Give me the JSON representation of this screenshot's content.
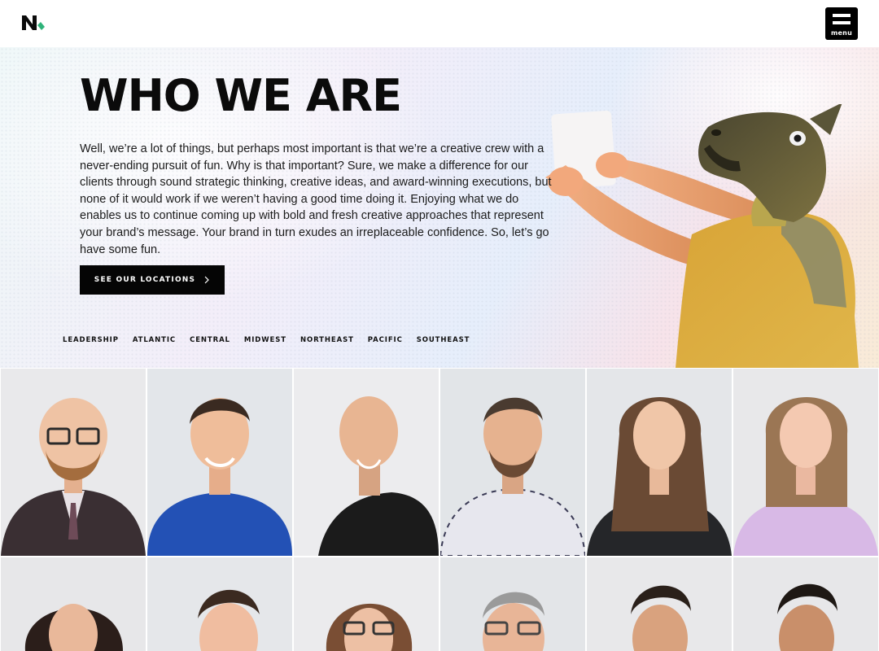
{
  "header": {
    "logo": "N",
    "logo_icon": "brand-logo-icon",
    "menu_label": "menu",
    "menu_icon": "hamburger-menu-icon"
  },
  "hero": {
    "title": "WHO WE ARE",
    "body": "Well, we’re a lot of things, but perhaps most important is that we’re a creative crew with a never-ending pursuit of fun. Why is that important? Sure, we make a difference for our clients through sound strategic thinking, creative ideas, and award-winning executions, but none of it would work if we weren’t having a good time doing it. Enjoying what we do enables us to continue coming up with bold and fresh creative approaches that represent your brand’s message. Your brand in turn exudes an irreplaceable confidence. So, let’s go have some fun.",
    "cta_label": "SEE OUR LOCATIONS",
    "cta_icon": "chevron-right-icon"
  },
  "regions": [
    "LEADERSHIP",
    "ATLANTIC",
    "CENTRAL",
    "MIDWEST",
    "NORTHEAST",
    "PACIFIC",
    "SOUTHEAST"
  ],
  "colors": {
    "accent": "#2fb37a",
    "button_bg": "#050505",
    "text": "#111111"
  }
}
